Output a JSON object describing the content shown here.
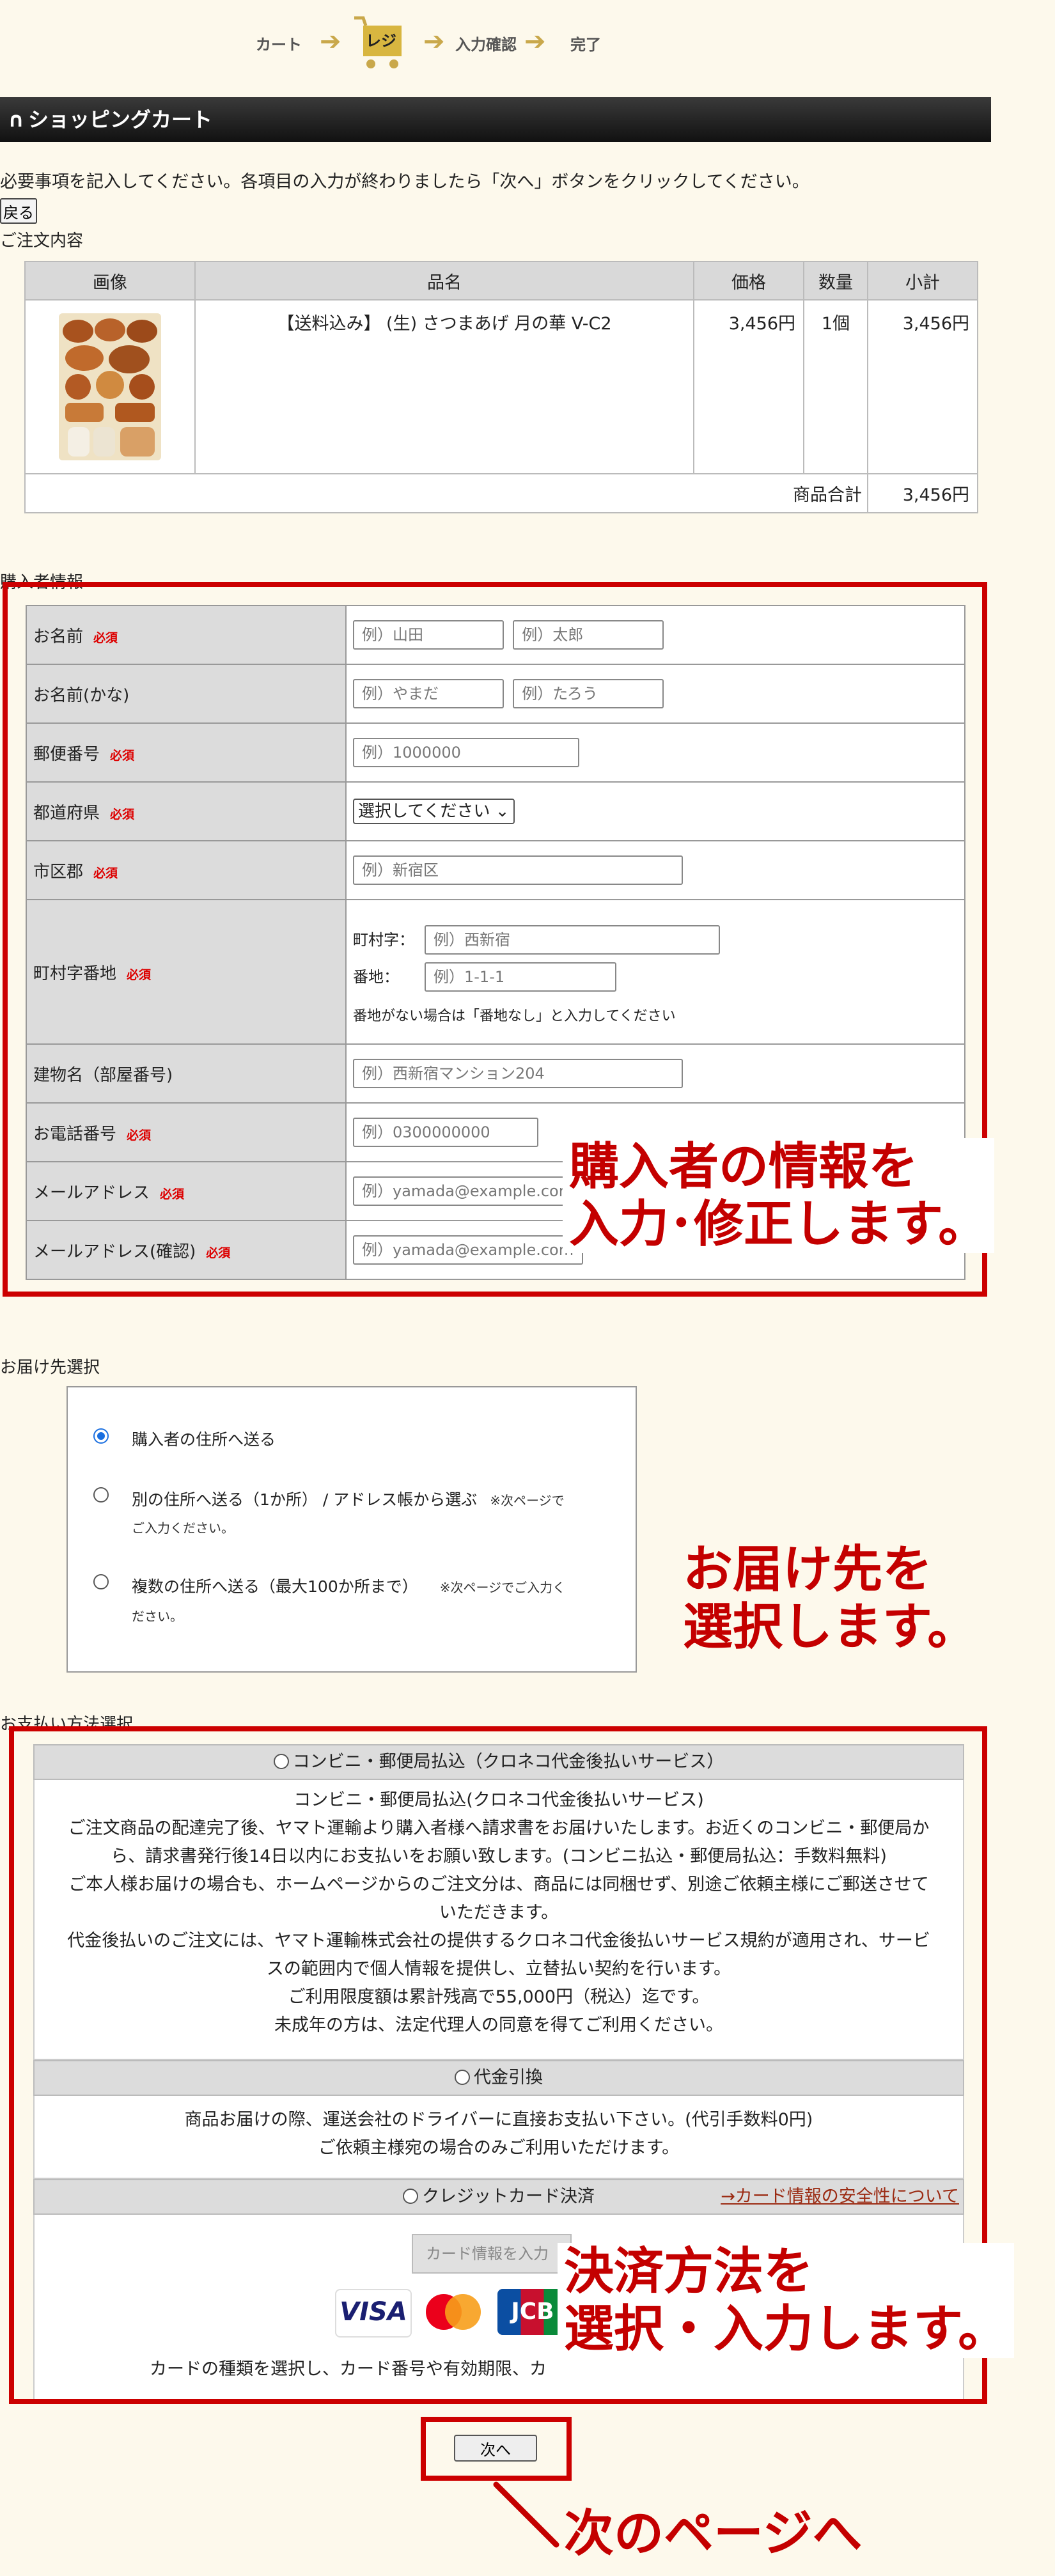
{
  "steps": [
    {
      "label": "カート"
    },
    {
      "label": "レジ"
    },
    {
      "label": "入力確認"
    },
    {
      "label": "完了"
    }
  ],
  "header": {
    "title": "ショッピングカート"
  },
  "intro": "必要事項を記入してください。各項目の入力が終わりましたら「次へ」ボタンをクリックしてください。",
  "back_label": "戻る",
  "order": {
    "section_label": "ご注文内容",
    "columns": [
      "画像",
      "品名",
      "価格",
      "数量",
      "小計"
    ],
    "items": [
      {
        "name": "【送料込み】 (生) さつまあげ 月の華 V-C2",
        "price": "3,456円",
        "qty": "1個",
        "subtotal": "3,456円"
      }
    ],
    "total_label": "商品合計",
    "total_value": "3,456円"
  },
  "buyer": {
    "section_label": "購入者情報",
    "required": "必須",
    "name_label": "お名前",
    "name_last_ph": "例）山田",
    "name_first_ph": "例）太郎",
    "kana_label": "お名前(かな)",
    "kana_last_ph": "例）やまだ",
    "kana_first_ph": "例）たろう",
    "zip_label": "郵便番号",
    "zip_ph": "例）1000000",
    "pref_label": "都道府県",
    "pref_value": "選択してください",
    "city_label": "市区郡",
    "city_ph": "例）新宿区",
    "town_label": "町村字番地",
    "town_sub_label": "町村字：",
    "town_ph": "例）西新宿",
    "banchi_sub_label": "番地：",
    "banchi_ph": "例）1-1-1",
    "banchi_note": "番地がない場合は「番地なし」と入力してください",
    "building_label": "建物名（部屋番号)",
    "building_ph": "例）西新宿マンション204",
    "tel_label": "お電話番号",
    "tel_ph": "例）0300000000",
    "mail_label": "メールアドレス",
    "mail_ph": "例）yamada@example.com",
    "mail_confirm_label": "メールアドレス(確認)",
    "mail_confirm_ph": "例）yamada@example.com",
    "annotation_line1": "購入者の情報を",
    "annotation_line2": "入力･修正します。"
  },
  "delivery": {
    "section_label": "お届け先選択",
    "option1": "購入者の住所へ送る",
    "option2": "別の住所へ送る（1か所） / アドレス帳から選ぶ",
    "option2_note_a": "※次ページで",
    "option2_note_b": "ご入力ください。",
    "option3": "複数の住所へ送る（最大100か所まで）",
    "option3_note_a": "※次ページでご入力く",
    "option3_note_b": "ださい。",
    "annotation_line1": "お届け先を",
    "annotation_line2": "選択します。"
  },
  "payment": {
    "section_label": "お支払い方法選択",
    "conv_title": "コンビニ・郵便局払込（クロネコ代金後払いサービス）",
    "conv_lines": [
      "コンビニ・郵便局払込(クロネコ代金後払いサービス)",
      "ご注文商品の配達完了後、ヤマト運輸より購入者様へ請求書をお届けいたします。お近くのコンビニ・郵便局か",
      "ら、請求書発行後14日以内にお支払いをお願い致します。(コンビニ払込・郵便局払込：手数料無料)",
      "ご本人様お届けの場合も、ホームページからのご注文分は、商品には同梱せず、別途ご依頼主様にご郵送させて",
      "いただきます。",
      "代金後払いのご注文には、ヤマト運輸株式会社の提供するクロネコ代金後払いサービス規約が適用され、サービ",
      "スの範囲内で個人情報を提供し、立替払い契約を行います。",
      "ご利用限度額は累計残高で55,000円（税込）迄です。",
      "未成年の方は、法定代理人の同意を得てご利用ください。"
    ],
    "cod_title": "代金引換",
    "cod_lines": [
      "商品お届けの際、運送会社のドライバーに直接お支払い下さい。(代引手数料0円)",
      "ご依頼主様宛の場合のみご利用いただけます。"
    ],
    "credit_title": "クレジットカード決済",
    "credit_link": "→カード情報の安全性について",
    "card_input_label": "カード情報を入力",
    "card_visa": "VISA",
    "card_jcb": "JCB",
    "card_note": "カードの種類を選択し、カード番号や有効期限、カ",
    "annotation_line1": "決済方法を",
    "annotation_line2": "選択・入力します。"
  },
  "next": {
    "label": "次へ",
    "annotation": "次のページへ"
  },
  "colors": {
    "accent_red": "#c00000",
    "step_gold": "#d8b640"
  }
}
